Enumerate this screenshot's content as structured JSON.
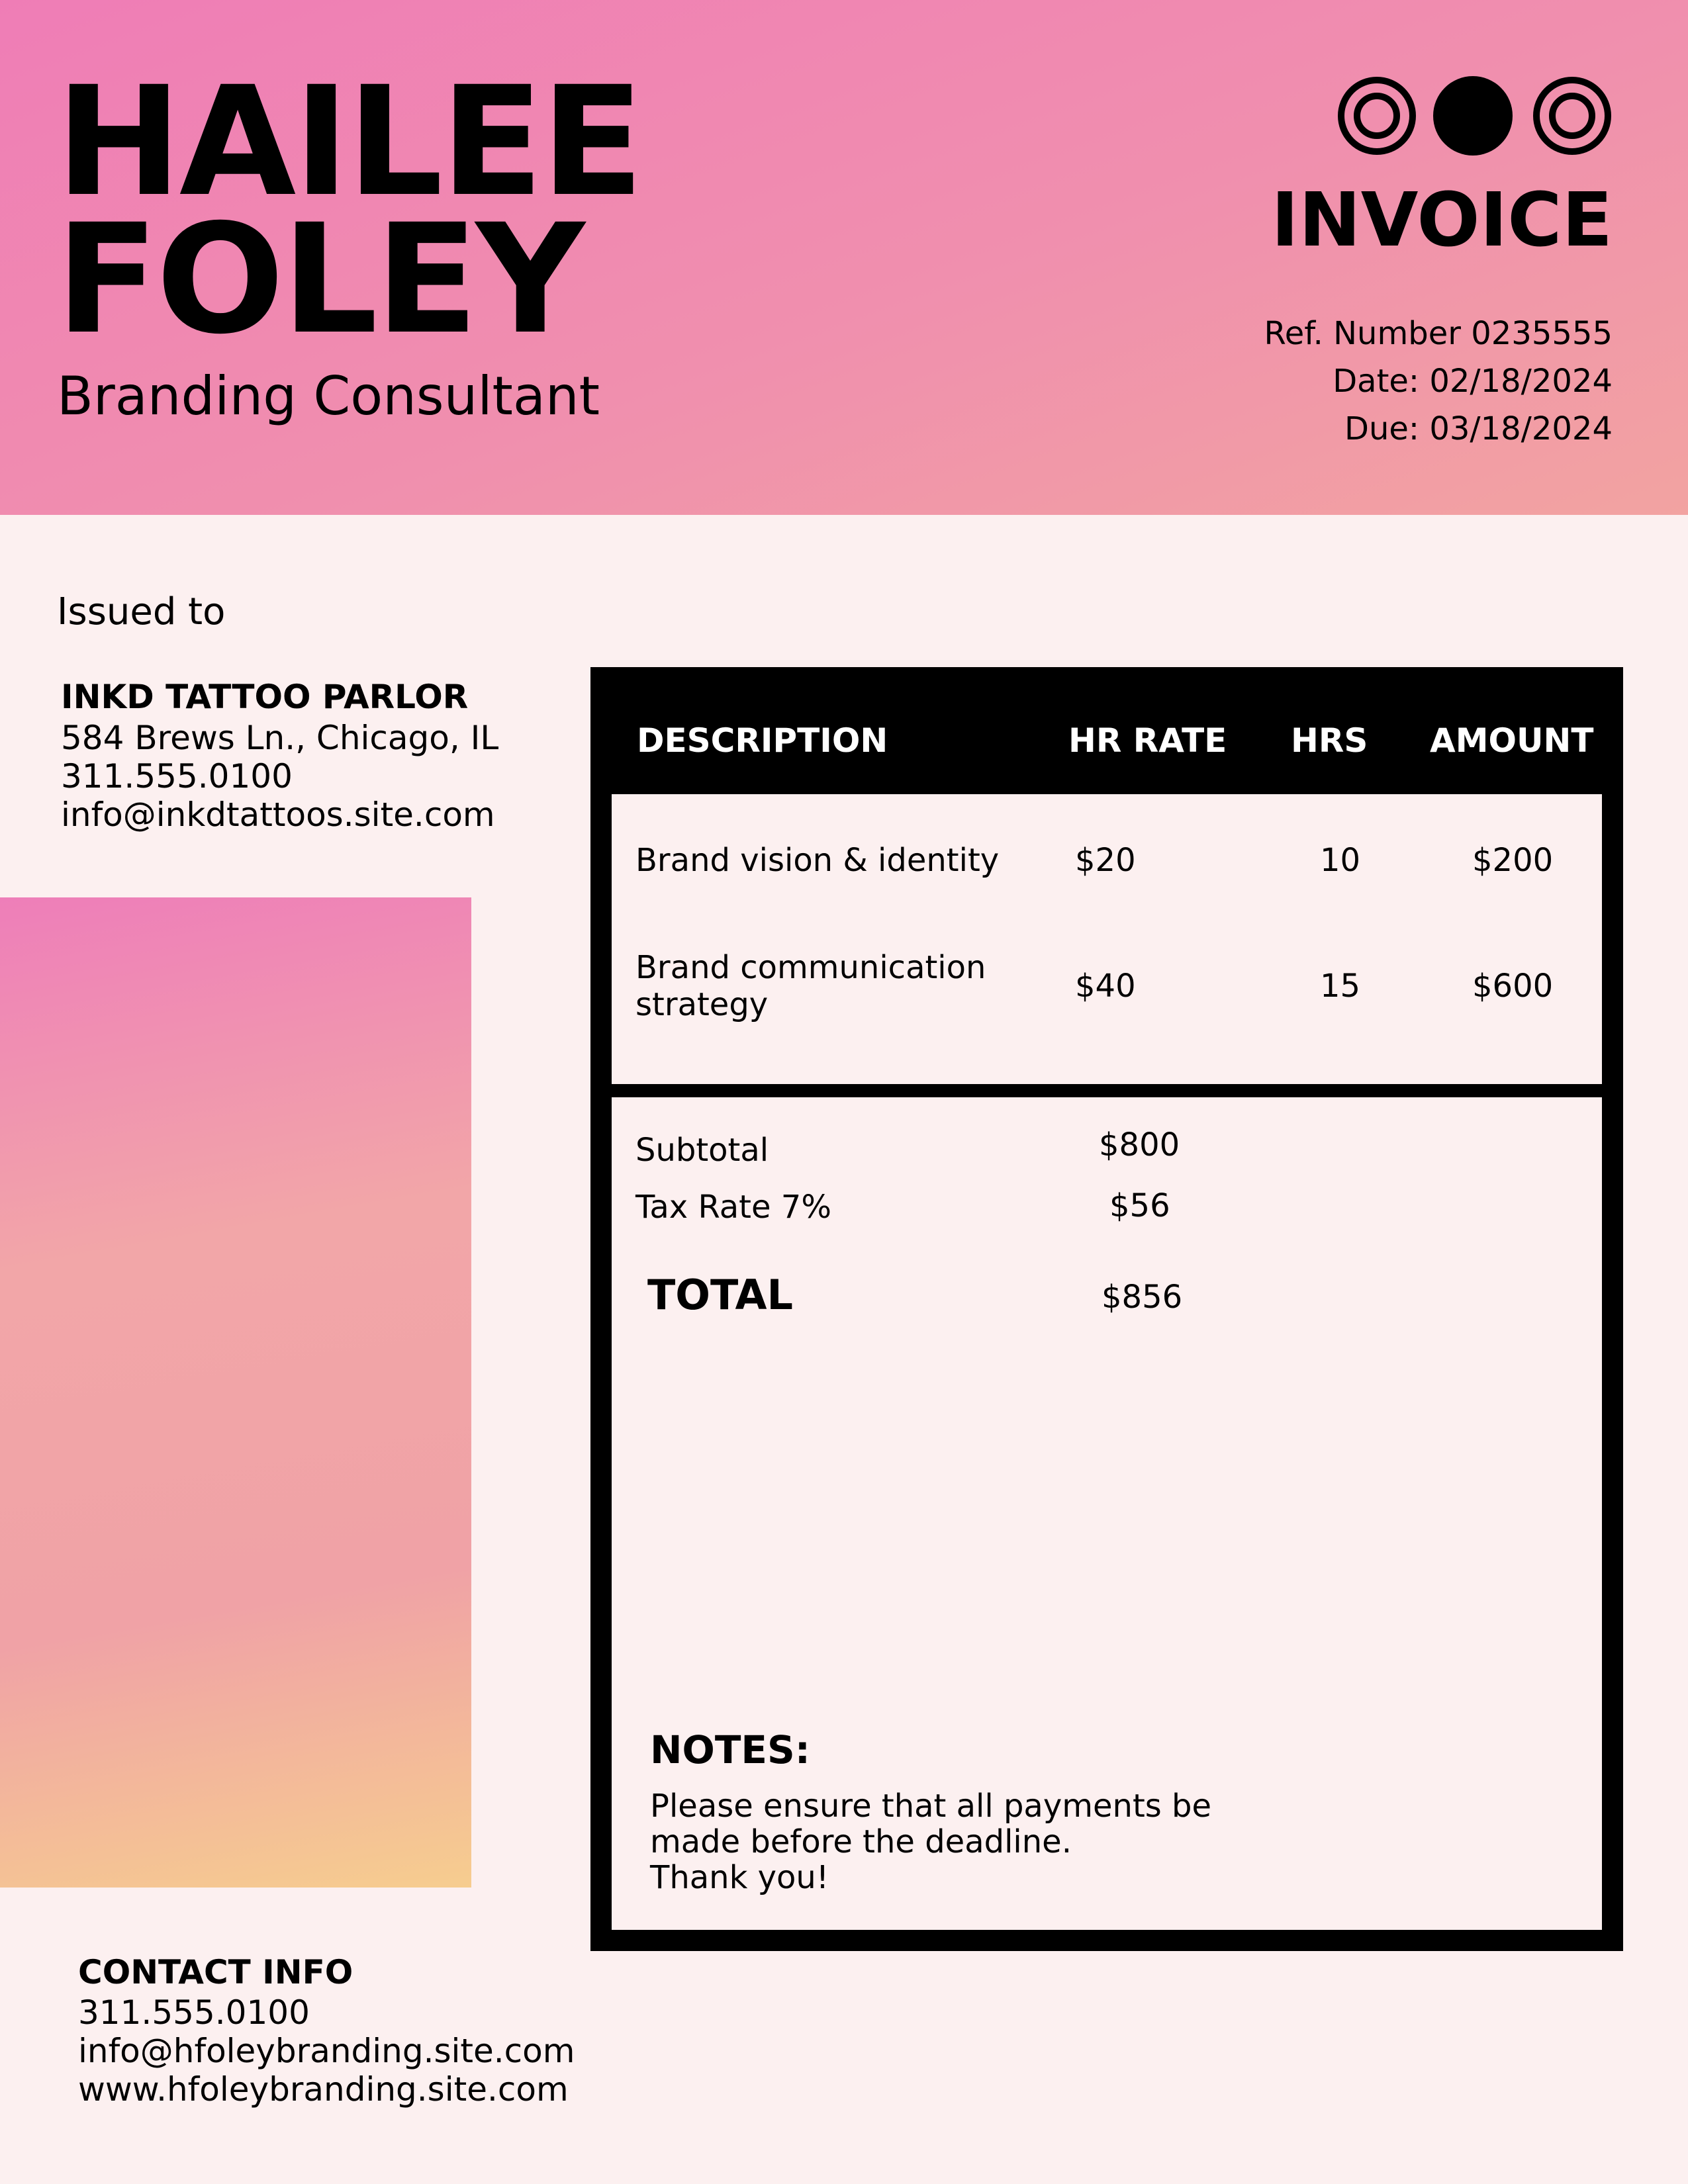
{
  "header": {
    "name_line1": "HAILEE",
    "name_line2": "FOLEY",
    "role": "Branding Consultant",
    "title": "INVOICE",
    "ref": "Ref. Number 0235555",
    "date": "Date: 02/18/2024",
    "due": "Due: 03/18/2024",
    "logo_icons": [
      "concentric-circle-icon",
      "filled-circle-icon",
      "concentric-circle-icon"
    ]
  },
  "client": {
    "label": "Issued to",
    "name": "INKD TATTOO PARLOR",
    "address": "584 Brews Ln., Chicago, IL",
    "phone": "311.555.0100",
    "email": "info@inkdtattoos.site.com"
  },
  "table": {
    "headers": {
      "description": "DESCRIPTION",
      "rate": "HR RATE",
      "hours": "HRS",
      "amount": "AMOUNT"
    },
    "items": [
      {
        "description": "Brand vision & identity",
        "rate": "$20",
        "hours": "10",
        "amount": "$200"
      },
      {
        "description": "Brand communication strategy",
        "rate": "$40",
        "hours": "15",
        "amount": "$600"
      }
    ]
  },
  "summary": {
    "subtotal_label": "Subtotal",
    "subtotal_value": "$800",
    "tax_label": "Tax Rate 7%",
    "tax_value": "$56",
    "total_label": "TOTAL",
    "total_value": "$856"
  },
  "notes": {
    "title": "NOTES:",
    "line1": "Please ensure that all payments be",
    "line2": "made before the deadline.",
    "line3": "Thank you!"
  },
  "contact": {
    "title": "CONTACT INFO",
    "phone": "311.555.0100",
    "email": "info@hfoleybranding.site.com",
    "website": "www.hfoleybranding.site.com"
  },
  "colors": {
    "background": "#fcf0f0",
    "gradient_pink": "#ef7db6",
    "gradient_peach": "#f2a3a1",
    "gradient_yellow": "#f6cd8f",
    "ink": "#000000"
  }
}
